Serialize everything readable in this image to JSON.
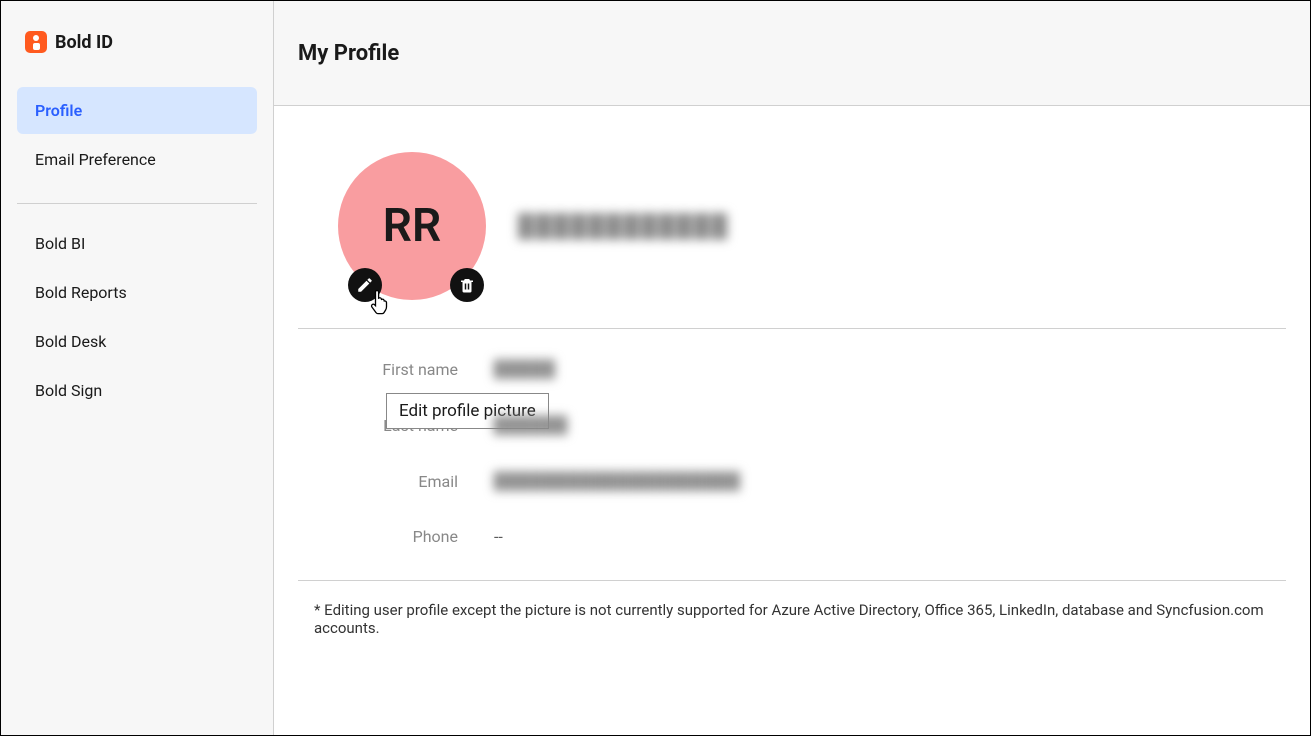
{
  "brand": {
    "name": "Bold ID"
  },
  "sidebar": {
    "items": [
      {
        "label": "Profile",
        "active": true
      },
      {
        "label": "Email Preference",
        "active": false
      }
    ],
    "product_items": [
      {
        "label": "Bold BI"
      },
      {
        "label": "Bold Reports"
      },
      {
        "label": "Bold Desk"
      },
      {
        "label": "Bold Sign"
      }
    ]
  },
  "header": {
    "title": "My Profile"
  },
  "profile": {
    "avatar_initials": "RR",
    "display_name_placeholder": "████████████",
    "tooltip_edit": "Edit profile picture",
    "fields": {
      "first_name_label": "First name",
      "first_name_value": "█████",
      "last_name_label": "Last name",
      "last_name_value": "██████",
      "email_label": "Email",
      "email_value": "████████████████████",
      "phone_label": "Phone",
      "phone_value": "--"
    }
  },
  "footer": {
    "note": "* Editing user profile except the picture is not currently supported for Azure Active Directory, Office 365, LinkedIn, database and Syncfusion.com accounts."
  }
}
